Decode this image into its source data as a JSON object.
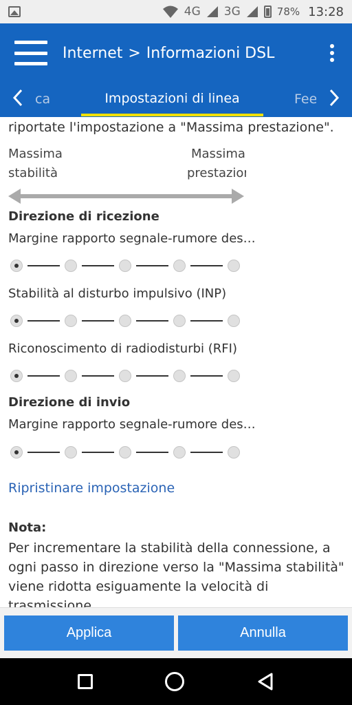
{
  "status": {
    "network_4g": "4G",
    "network_3g": "3G",
    "battery": "78%",
    "time": "13:28",
    "icons": [
      "image-icon",
      "wifi-icon",
      "signal-icon",
      "battery-icon"
    ]
  },
  "appbar": {
    "breadcrumb_root": "Internet",
    "separator": ">",
    "breadcrumb_page": "Informazioni DSL"
  },
  "tabs": {
    "prev": "ca",
    "active": "Impostazioni di linea",
    "next": "Fee"
  },
  "content": {
    "intro_line": "riportate l'impostazione a \"Massima prestazione\".",
    "scale_left_1": "Massima",
    "scale_left_2": "stabilità",
    "scale_right_1": "Massima",
    "scale_right_2": "prestazioni",
    "section_receive": "Direzione di ricezione",
    "setting_snr_rx": "Margine rapporto segnale-rumore des…",
    "setting_inp": "Stabilità al disturbo impulsivo (INP)",
    "setting_rfi": "Riconoscimento di radiodisturbi (RFI)",
    "section_send": "Direzione di invio",
    "setting_snr_tx": "Margine rapporto segnale-rumore des…",
    "reset_link": "Ripristinare impostazione",
    "note_title": "Nota:",
    "note_body": "Per incrementare la stabilità della connessione, a ogni passo in direzione verso la \"Massima stabilità\" viene ridotta esiguamente la velocità di trasmissione."
  },
  "sliders": {
    "snr_rx": {
      "steps": 5,
      "selected": 1
    },
    "inp": {
      "steps": 5,
      "selected": 1
    },
    "rfi": {
      "steps": 5,
      "selected": 1
    },
    "snr_tx": {
      "steps": 5,
      "selected": 1
    }
  },
  "buttons": {
    "apply": "Applica",
    "cancel": "Annulla"
  },
  "colors": {
    "primary": "#1565c0",
    "tab_indicator": "#f0e000",
    "button": "#2f83dc",
    "link": "#2a63b5"
  }
}
